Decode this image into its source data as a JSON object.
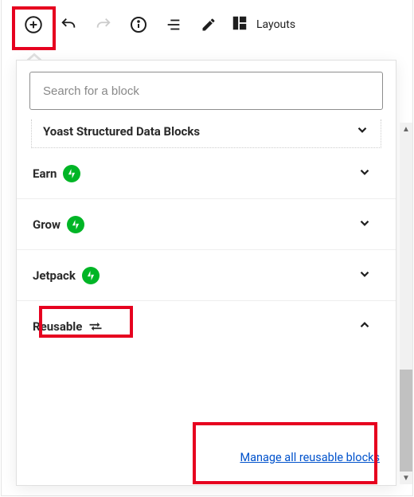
{
  "toolbar": {
    "layouts_label": "Layouts"
  },
  "search": {
    "placeholder": "Search for a block"
  },
  "categories": {
    "yoast": "Yoast Structured Data Blocks",
    "earn": "Earn",
    "grow": "Grow",
    "jetpack": "Jetpack",
    "reusable": "Reusable"
  },
  "footer": {
    "manage_link": "Manage all reusable blocks"
  }
}
